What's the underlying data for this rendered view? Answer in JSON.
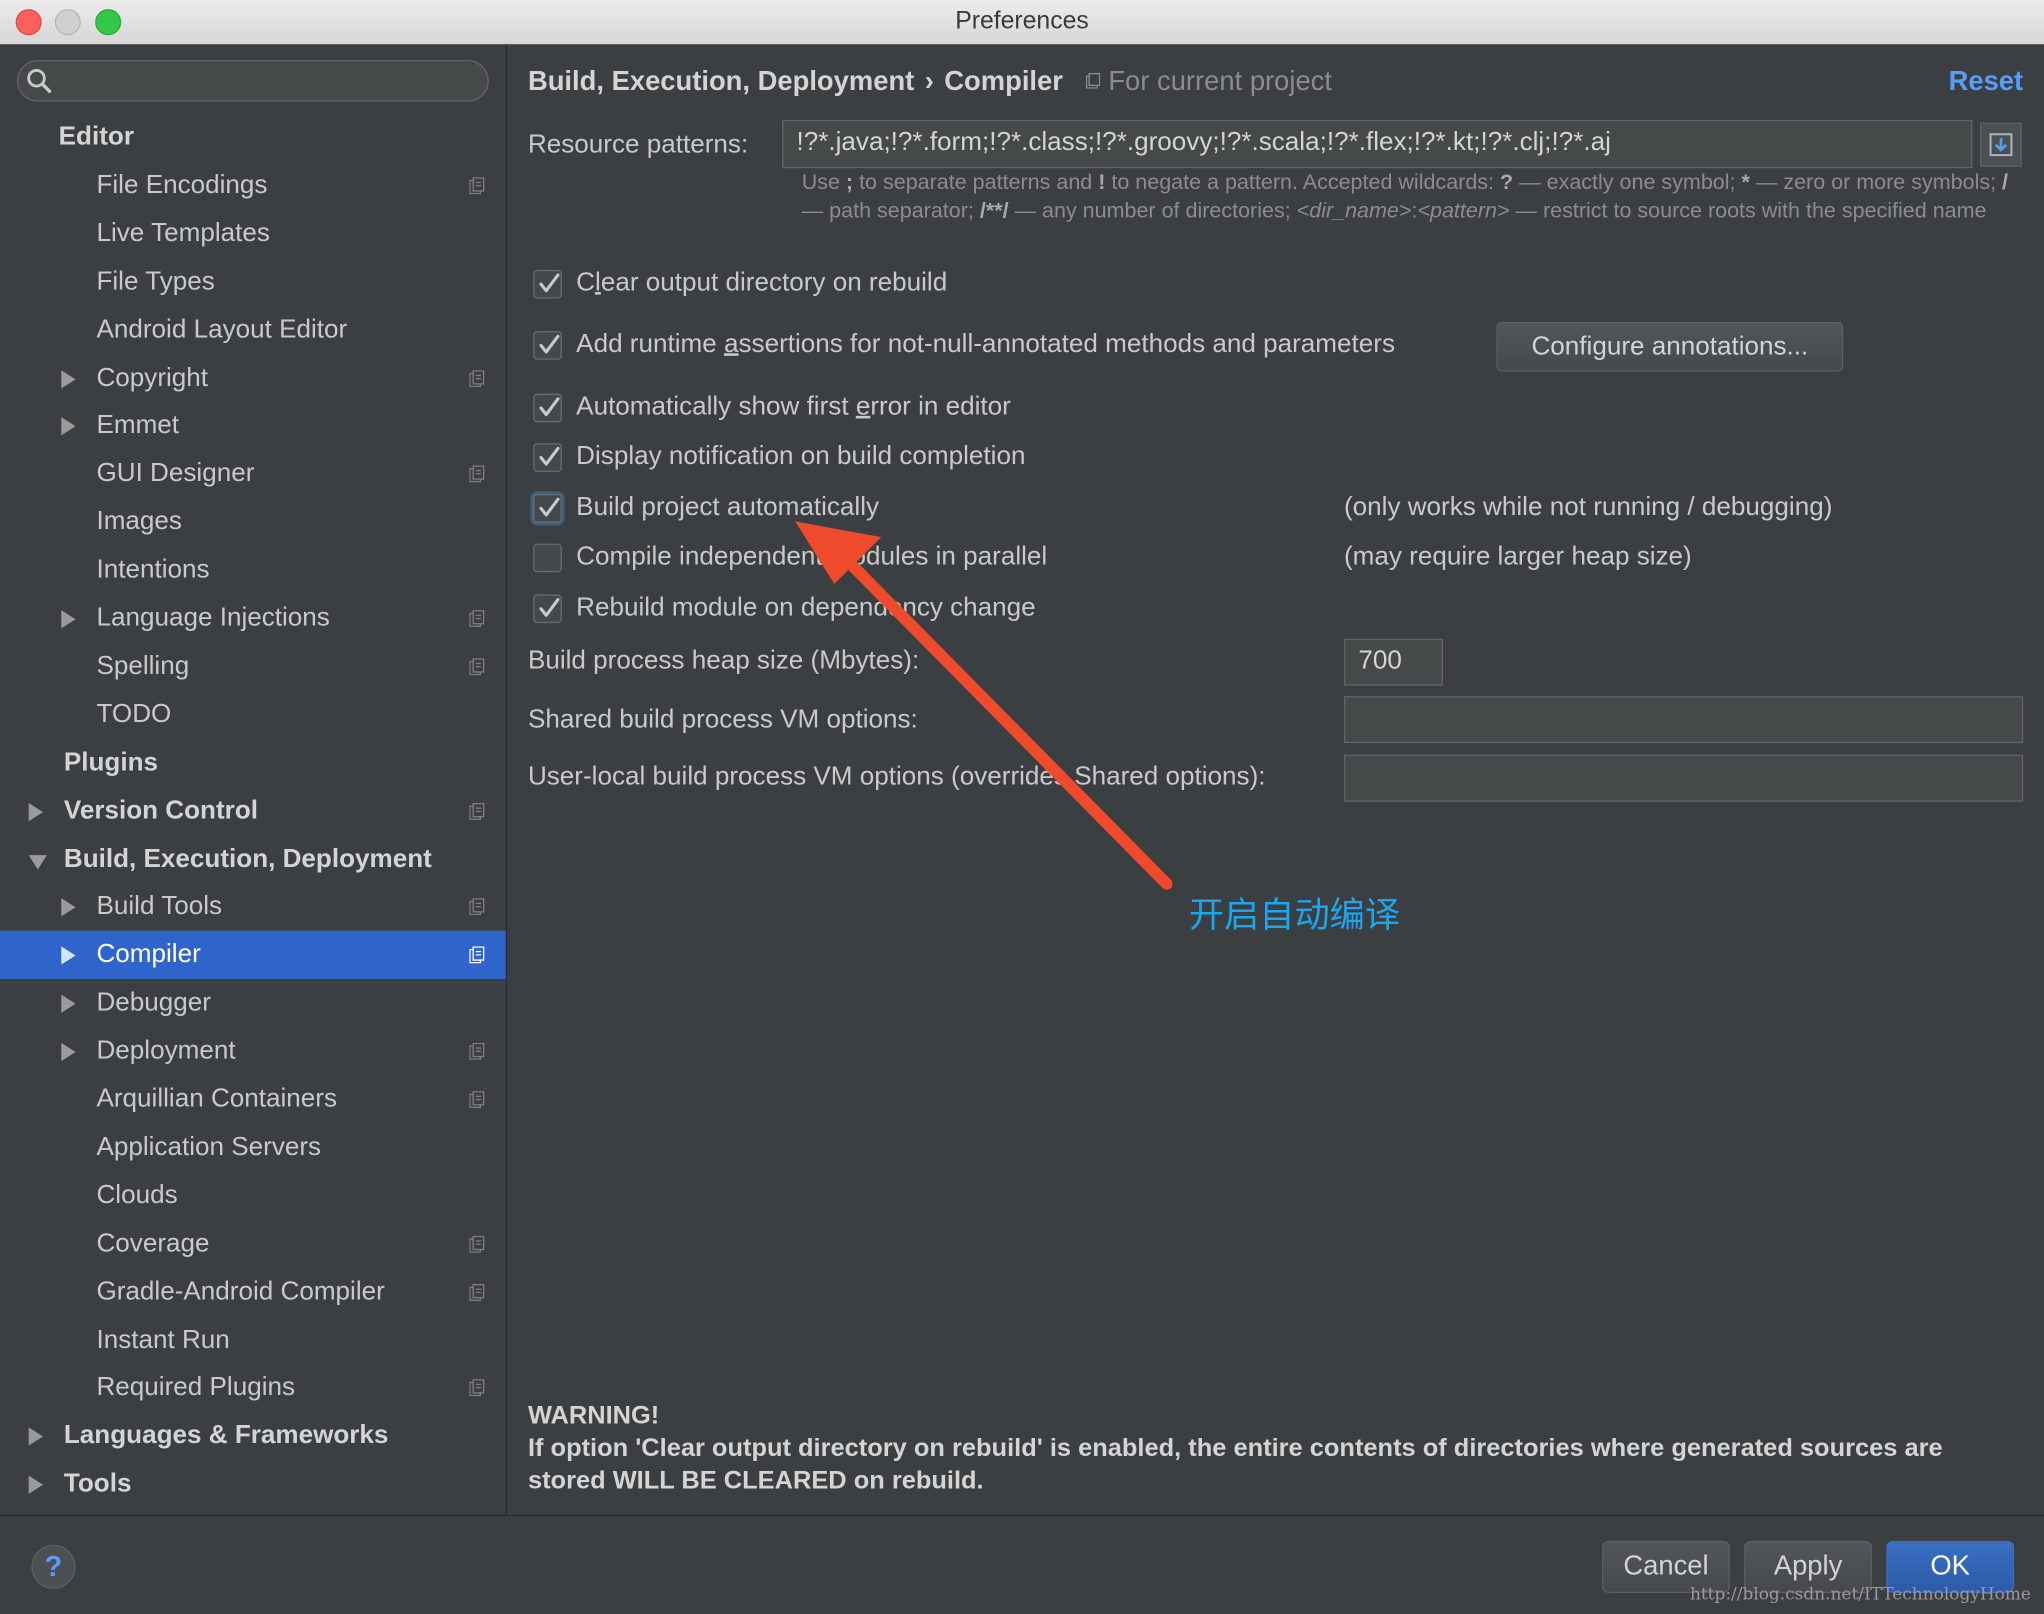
{
  "window": {
    "title": "Preferences"
  },
  "search": {
    "placeholder": ""
  },
  "sidebar": {
    "items": [
      {
        "label": "Editor",
        "bold": true,
        "level": 0,
        "expander": "none",
        "project_scope": false
      },
      {
        "label": "File Encodings",
        "level": 1,
        "expander": "none",
        "project_scope": true
      },
      {
        "label": "Live Templates",
        "level": 1,
        "expander": "none",
        "project_scope": false
      },
      {
        "label": "File Types",
        "level": 1,
        "expander": "none",
        "project_scope": false
      },
      {
        "label": "Android Layout Editor",
        "level": 1,
        "expander": "none",
        "project_scope": false
      },
      {
        "label": "Copyright",
        "level": 1,
        "expander": "collapsed",
        "project_scope": true
      },
      {
        "label": "Emmet",
        "level": 1,
        "expander": "collapsed",
        "project_scope": false
      },
      {
        "label": "GUI Designer",
        "level": 1,
        "expander": "none",
        "project_scope": true
      },
      {
        "label": "Images",
        "level": 1,
        "expander": "none",
        "project_scope": false
      },
      {
        "label": "Intentions",
        "level": 1,
        "expander": "none",
        "project_scope": false
      },
      {
        "label": "Language Injections",
        "level": 1,
        "expander": "collapsed",
        "project_scope": true
      },
      {
        "label": "Spelling",
        "level": 1,
        "expander": "none",
        "project_scope": true
      },
      {
        "label": "TODO",
        "level": 1,
        "expander": "none",
        "project_scope": false
      },
      {
        "label": "Plugins",
        "bold": true,
        "level": 0,
        "expander": "none",
        "project_scope": false
      },
      {
        "label": "Version Control",
        "bold": true,
        "level": 0,
        "expander": "collapsed",
        "project_scope": true
      },
      {
        "label": "Build, Execution, Deployment",
        "bold": true,
        "level": 0,
        "expander": "expanded",
        "project_scope": false
      },
      {
        "label": "Build Tools",
        "level": 1,
        "expander": "collapsed",
        "project_scope": true
      },
      {
        "label": "Compiler",
        "level": 1,
        "expander": "collapsed",
        "project_scope": true,
        "selected": true
      },
      {
        "label": "Debugger",
        "level": 1,
        "expander": "collapsed",
        "project_scope": false
      },
      {
        "label": "Deployment",
        "level": 1,
        "expander": "collapsed",
        "project_scope": true
      },
      {
        "label": "Arquillian Containers",
        "level": 1,
        "expander": "none",
        "project_scope": true
      },
      {
        "label": "Application Servers",
        "level": 1,
        "expander": "none",
        "project_scope": false
      },
      {
        "label": "Clouds",
        "level": 1,
        "expander": "none",
        "project_scope": false
      },
      {
        "label": "Coverage",
        "level": 1,
        "expander": "none",
        "project_scope": true
      },
      {
        "label": "Gradle-Android Compiler",
        "level": 1,
        "expander": "none",
        "project_scope": true
      },
      {
        "label": "Instant Run",
        "level": 1,
        "expander": "none",
        "project_scope": false
      },
      {
        "label": "Required Plugins",
        "level": 1,
        "expander": "none",
        "project_scope": true
      },
      {
        "label": "Languages & Frameworks",
        "bold": true,
        "level": 0,
        "expander": "collapsed",
        "project_scope": false
      },
      {
        "label": "Tools",
        "bold": true,
        "level": 0,
        "expander": "collapsed",
        "project_scope": false
      }
    ]
  },
  "header": {
    "breadcrumb_parent": "Build, Execution, Deployment",
    "breadcrumb_separator": "›",
    "breadcrumb_current": "Compiler",
    "scope_text": "For current project",
    "reset_label": "Reset"
  },
  "resource_patterns": {
    "label": "Resource patterns:",
    "value": "!?*.java;!?*.form;!?*.class;!?*.groovy;!?*.scala;!?*.flex;!?*.kt;!?*.clj;!?*.aj"
  },
  "hint": {
    "p1": "Use ",
    "b1": ";",
    "p2": " to separate patterns and ",
    "b2": "!",
    "p3": " to negate a pattern. Accepted wildcards: ",
    "b3": "?",
    "p4": " — exactly one symbol; ",
    "b4": "*",
    "p5": " — zero or more symbols; ",
    "b5": "/",
    "p6": " — path separator; ",
    "b6": "/**/",
    "p7": " — any number of directories; ",
    "i1": "<dir_name>",
    "p8": ":",
    "i2": "<pattern>",
    "p9": " — restrict to source roots with the specified name"
  },
  "options": {
    "clear_output": {
      "pre": "C",
      "mnemonic": "l",
      "post": "ear output directory on rebuild",
      "checked": true
    },
    "runtime_assertions": {
      "pre": "Add runtime ",
      "mnemonic": "a",
      "post": "ssertions for not-null-annotated methods and parameters",
      "checked": true
    },
    "configure_annotations_label": "Configure annotations...",
    "show_first_error": {
      "pre": "Automatically show first ",
      "mnemonic": "e",
      "post": "rror in editor",
      "checked": true
    },
    "notify_build": {
      "label": "Display notification on build completion",
      "checked": true
    },
    "build_automatically": {
      "label": "Build project automatically",
      "checked": true,
      "note": "(only works while not running / debugging)"
    },
    "compile_parallel": {
      "label": "Compile independent modules in parallel",
      "checked": false,
      "note": "(may require larger heap size)"
    },
    "rebuild_on_dependency": {
      "label": "Rebuild module on dependency change",
      "checked": true
    }
  },
  "heap_size": {
    "label": "Build process heap size (Mbytes):",
    "value": "700"
  },
  "shared_vm": {
    "label": "Shared build process VM options:",
    "value": ""
  },
  "user_vm": {
    "label": "User-local build process VM options (overrides Shared options):",
    "value": ""
  },
  "warning": {
    "title": "WARNING!",
    "text": "If option 'Clear output directory on rebuild' is enabled, the entire contents of directories where generated sources are stored WILL BE CLEARED on rebuild."
  },
  "annotation": {
    "text": "开启自动编译",
    "color": "#1aa7ef",
    "arrow_color": "#f04a2c"
  },
  "footer": {
    "help": "?",
    "cancel": "Cancel",
    "apply": "Apply",
    "ok": "OK"
  },
  "watermark": "http://blog.csdn.net/ITTechnologyHome",
  "colors": {
    "accent": "#589df6",
    "selection": "#2f65ca",
    "panel": "#3c3f41"
  }
}
